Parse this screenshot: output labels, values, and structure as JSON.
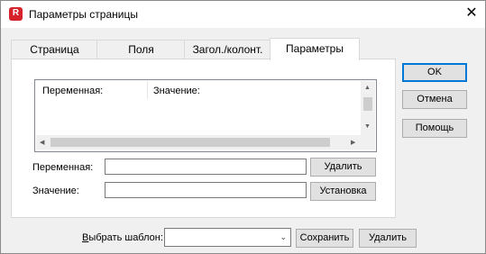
{
  "window": {
    "title": "Параметры страницы",
    "app_icon_letter": "R",
    "close_glyph": "✕"
  },
  "tabs": [
    {
      "label": "Страница",
      "active": false
    },
    {
      "label": "Поля",
      "active": false
    },
    {
      "label": "Загол./колонт.",
      "active": false
    },
    {
      "label": "Параметры",
      "active": true
    }
  ],
  "list": {
    "columns": [
      "Переменная:",
      "Значение:"
    ],
    "arrow_up": "▲",
    "arrow_down": "▼",
    "arrow_left": "◀",
    "arrow_right": "▶"
  },
  "fields": {
    "variable_label": "Переменная:",
    "variable_value": "",
    "value_label": "Значение:",
    "value_value": ""
  },
  "buttons": {
    "delete_variable": "Удалить",
    "set_value": "Установка",
    "ok": "OK",
    "cancel": "Отмена",
    "help": "Помощь"
  },
  "footer": {
    "template_label_accel": "В",
    "template_label_rest": "ыбрать шаблон:",
    "template_value": "",
    "combo_arrow": "⌄",
    "save": "Сохранить",
    "delete": "Удалить"
  }
}
